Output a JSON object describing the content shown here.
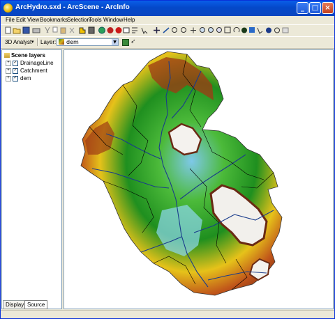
{
  "window": {
    "title": "ArcHydro.sxd - ArcScene - ArcInfo"
  },
  "menu": [
    "File",
    "Edit",
    "View",
    "Bookmarks",
    "Selection",
    "Tools",
    "Window",
    "Help"
  ],
  "toolbar2": {
    "analyst_label": "3D Analyst",
    "layer_label": "Layer:",
    "layer_value": "dem"
  },
  "toc": {
    "header": "Scene layers",
    "layers": [
      {
        "name": "DrainageLine",
        "checked": true
      },
      {
        "name": "Catchment",
        "checked": true
      },
      {
        "name": "dem",
        "checked": true
      }
    ]
  },
  "tabs": {
    "display": "Display",
    "source": "Source",
    "active": "Source"
  },
  "colors": {
    "title_bar": "#0a5ee8",
    "chrome": "#ece9d8",
    "drainage": "#1a3c8c",
    "catchment": "#000000"
  },
  "scene": {
    "description_icon": "terrain-dem-3d"
  }
}
